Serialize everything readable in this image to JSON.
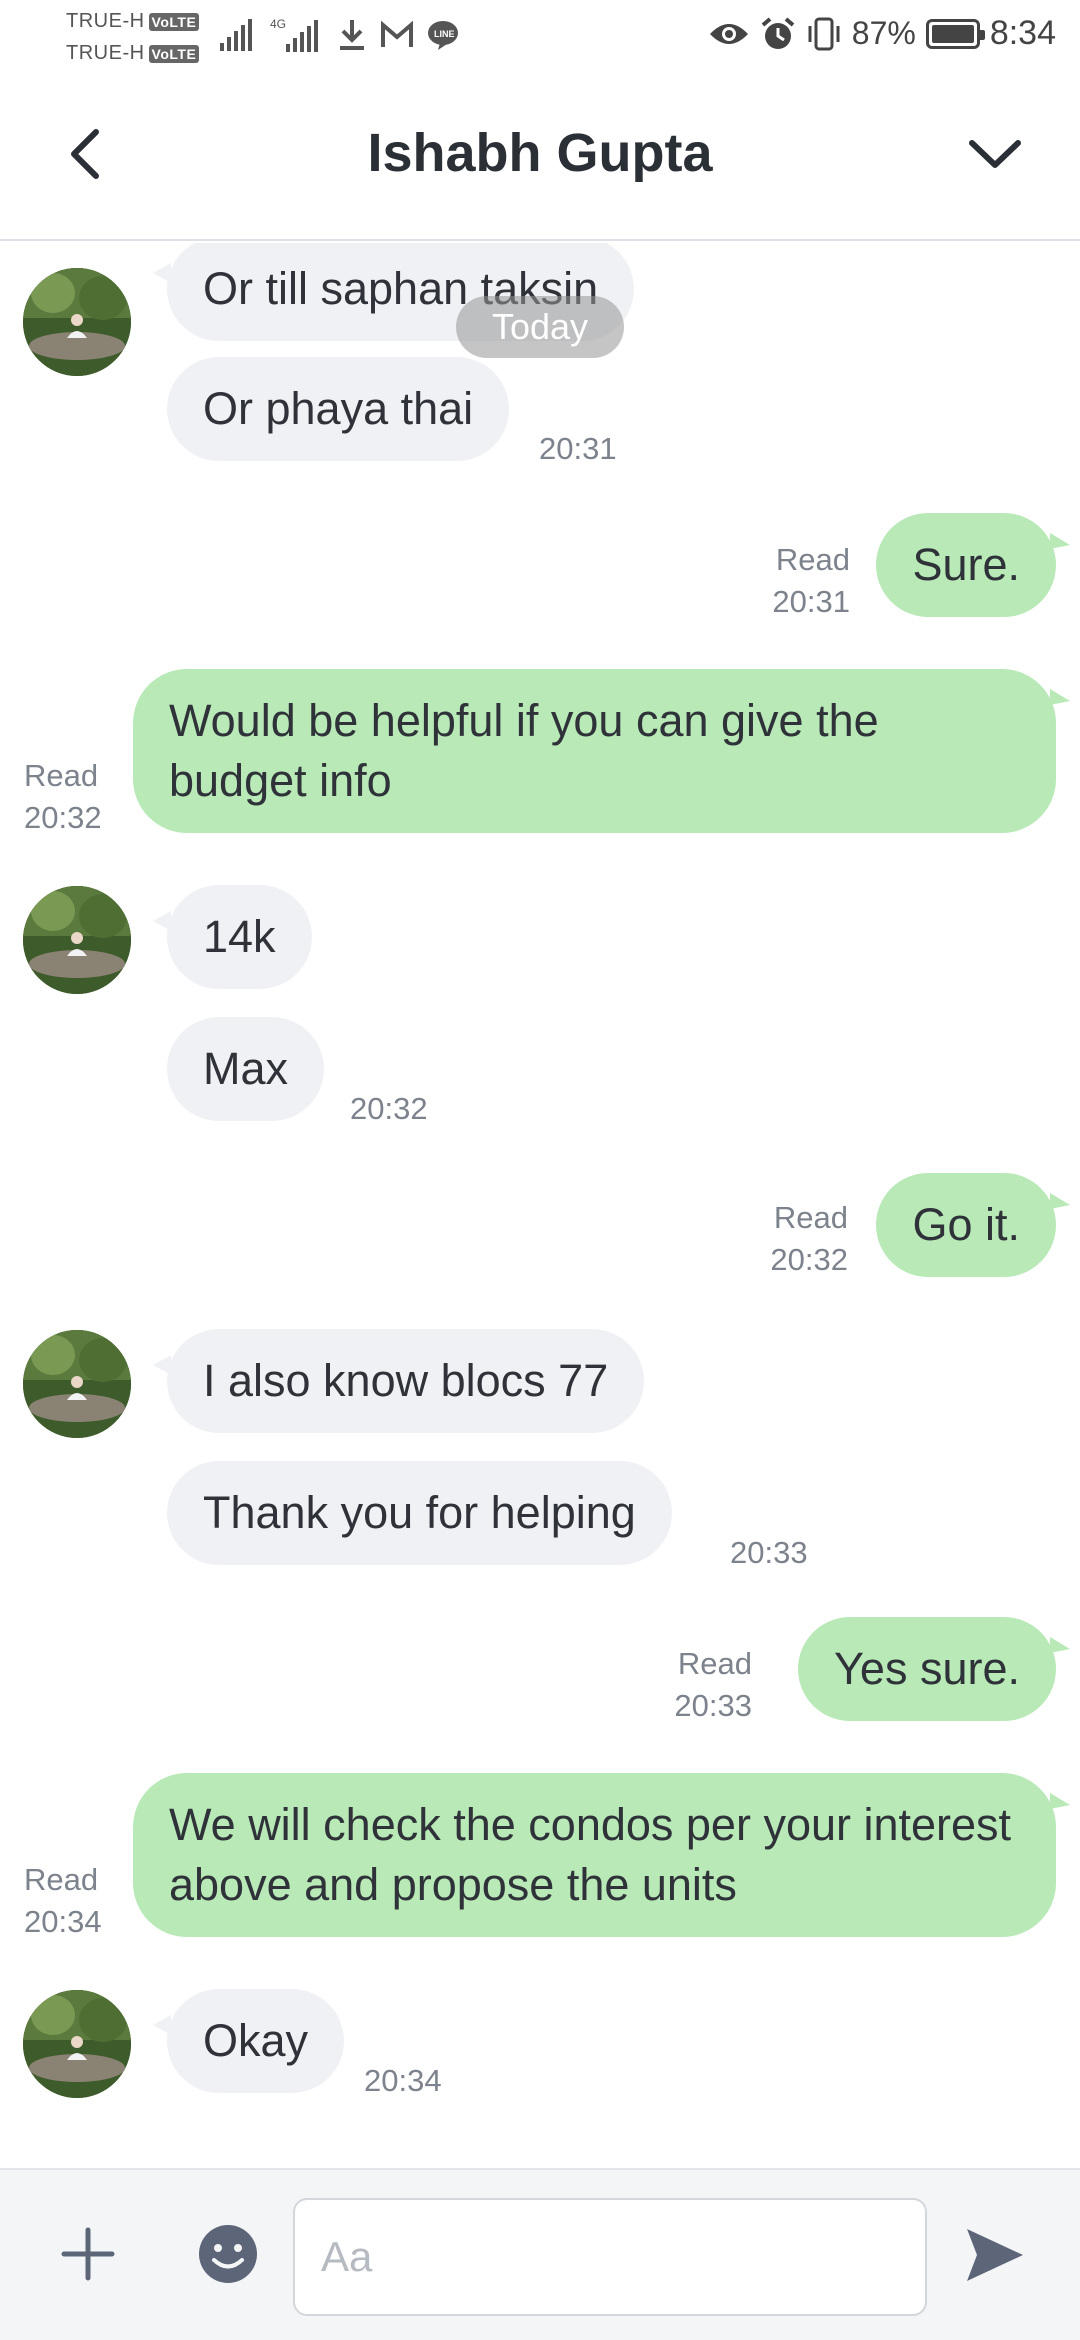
{
  "status_bar": {
    "carrier1": "TRUE-H",
    "carrier2": "TRUE-H",
    "volte": "VoLTE",
    "network": "4G",
    "battery_percent": "87%",
    "battery_level": 0.87,
    "time": "8:34",
    "icons_left": [
      "signal-icon",
      "signal-4g-icon",
      "download-icon",
      "gmail-icon",
      "line-icon"
    ],
    "icons_right": [
      "eye-icon",
      "alarm-icon",
      "vibrate-icon",
      "battery-icon"
    ]
  },
  "header": {
    "title": "Ishabh Gupta",
    "back_icon": "back-arrow-icon",
    "menu_icon": "chevron-down-icon"
  },
  "chat": {
    "date_pill": "Today",
    "messages": [
      {
        "side": "in",
        "text": "Or till saphan taksin",
        "time": ""
      },
      {
        "side": "in",
        "text": "Or phaya thai",
        "time": "20:31"
      },
      {
        "side": "out",
        "text": "Sure.",
        "status": "Read",
        "time": "20:31"
      },
      {
        "side": "out",
        "text": "Would be helpful if you can give the budget info",
        "status": "Read",
        "time": "20:32"
      },
      {
        "side": "in",
        "text": "14k",
        "time": ""
      },
      {
        "side": "in",
        "text": "Max",
        "time": "20:32"
      },
      {
        "side": "out",
        "text": "Go it.",
        "status": "Read",
        "time": "20:32"
      },
      {
        "side": "in",
        "text": "I also know blocs 77",
        "time": ""
      },
      {
        "side": "in",
        "text": "Thank you for helping",
        "time": "20:33"
      },
      {
        "side": "out",
        "text": "Yes sure.",
        "status": "Read",
        "time": "20:33"
      },
      {
        "side": "out",
        "text": "We will check the condos per your interest above and propose the units",
        "status": "Read",
        "time": "20:34"
      },
      {
        "side": "in",
        "text": "Okay",
        "time": "20:34"
      }
    ]
  },
  "composer": {
    "placeholder": "Aa",
    "value": "",
    "plus_icon": "plus-icon",
    "emoji_icon": "emoji-icon",
    "send_icon": "send-icon"
  },
  "colors": {
    "outgoing_bubble": "#b8e9b7",
    "incoming_bubble": "#f0f1f4",
    "meta_text": "#7d838c",
    "icon_color": "#5d6679"
  }
}
